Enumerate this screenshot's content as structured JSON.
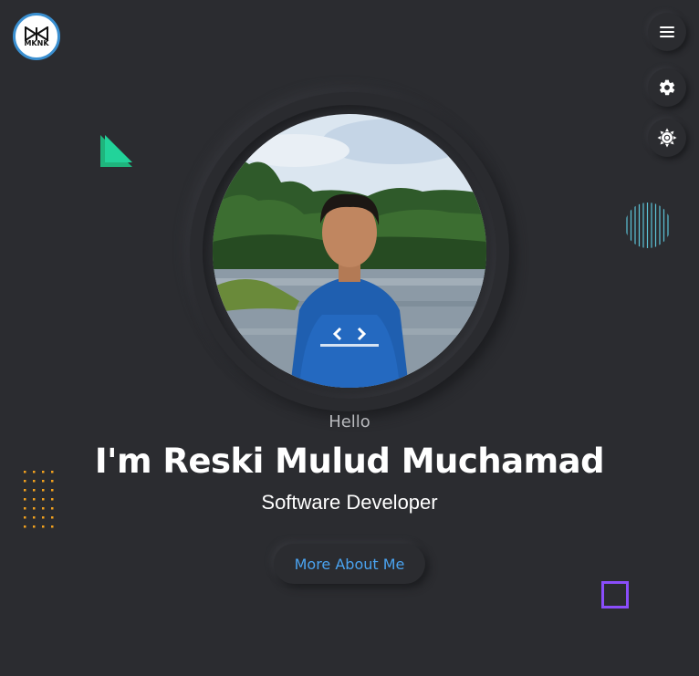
{
  "logo": {
    "text": "MKNK",
    "border_color": "#3a8fd0"
  },
  "controls": {
    "menu_icon": "hamburger-icon",
    "settings_icon": "gear-icon",
    "theme_icon": "sun-icon"
  },
  "hero": {
    "greeting": "Hello",
    "name": "I'm Reski Mulud Muchamad",
    "role": "Software Developer",
    "cta_label": "More About Me",
    "accent_color": "#4aa3f0"
  },
  "decorations": {
    "triangle_colors": [
      "#1fb57d",
      "#22d39a"
    ],
    "lines_color": "#5cc3d8",
    "dots_color": "#f3a21e",
    "square_color": "#8a4dfb"
  },
  "theme": {
    "background": "#2b2c30"
  }
}
